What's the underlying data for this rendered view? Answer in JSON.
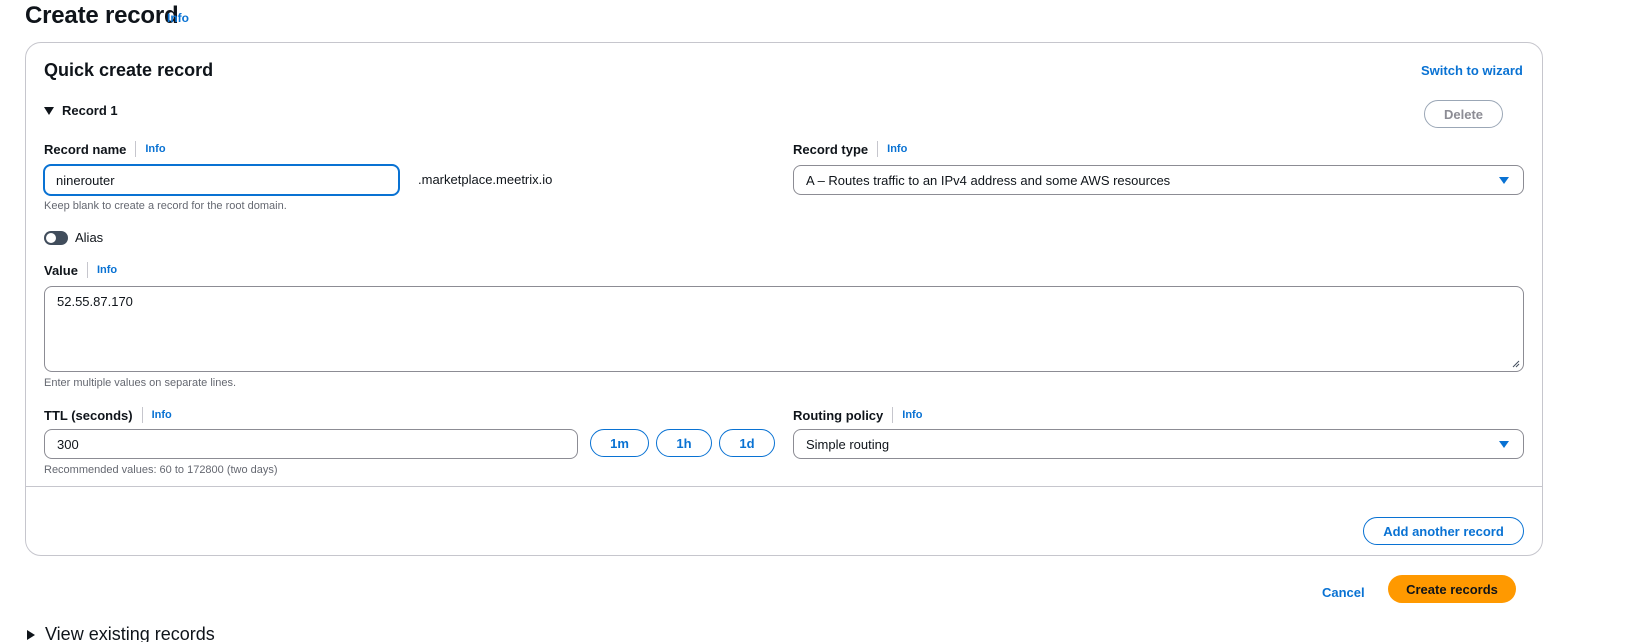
{
  "page": {
    "title": "Create record",
    "info": "Info"
  },
  "quick_create": {
    "title": "Quick create record",
    "switch_wizard": "Switch to wizard",
    "record_expander": "Record 1",
    "delete_label": "Delete",
    "record_name": {
      "label": "Record name",
      "info": "Info",
      "value": "ninerouter",
      "suffix": ".marketplace.meetrix.io",
      "hint": "Keep blank to create a record for the root domain."
    },
    "record_type": {
      "label": "Record type",
      "info": "Info",
      "selected": "A – Routes traffic to an IPv4 address and some AWS resources"
    },
    "alias": {
      "label": "Alias",
      "enabled": false
    },
    "value": {
      "label": "Value",
      "info": "Info",
      "text": "52.55.87.170",
      "hint": "Enter multiple values on separate lines."
    },
    "ttl": {
      "label": "TTL (seconds)",
      "info": "Info",
      "value": "300",
      "hint": "Recommended values: 60 to 172800 (two days)",
      "presets": [
        "1m",
        "1h",
        "1d"
      ]
    },
    "routing_policy": {
      "label": "Routing policy",
      "info": "Info",
      "selected": "Simple routing"
    },
    "add_another": "Add another record"
  },
  "footer": {
    "cancel": "Cancel",
    "create": "Create records"
  },
  "existing": {
    "label": "View existing records"
  },
  "colors": {
    "accent": "#0972d3",
    "primary_button": "#ff9900",
    "border": "#8c8c94"
  }
}
